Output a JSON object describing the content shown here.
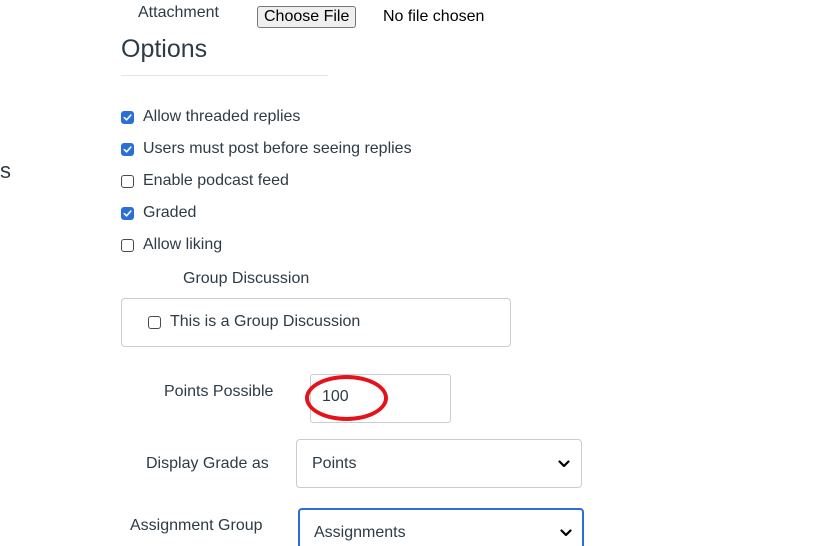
{
  "attachment": {
    "label": "Attachment",
    "button_label": "Choose File",
    "status": "No file chosen"
  },
  "options": {
    "title": "Options",
    "side_fragment": "s",
    "checkboxes": [
      {
        "label": "Allow threaded replies",
        "checked": true
      },
      {
        "label": "Users must post before seeing replies",
        "checked": true
      },
      {
        "label": "Enable podcast feed",
        "checked": false
      },
      {
        "label": "Graded",
        "checked": true
      },
      {
        "label": "Allow liking",
        "checked": false
      }
    ]
  },
  "group_discussion": {
    "label": "Group Discussion",
    "checkbox_label": "This is a Group Discussion",
    "checked": false
  },
  "points_possible": {
    "label": "Points Possible",
    "value": "100"
  },
  "display_grade": {
    "label": "Display Grade as",
    "selected": "Points"
  },
  "assignment_group": {
    "label": "Assignment Group",
    "selected": "Assignments"
  },
  "colors": {
    "accent": "#2b6fd6",
    "highlight": "#e3121b",
    "text": "#2d3b45"
  },
  "icons": {
    "checkbox_checked": "checkmark-icon",
    "select": "chevron-down-icon"
  }
}
